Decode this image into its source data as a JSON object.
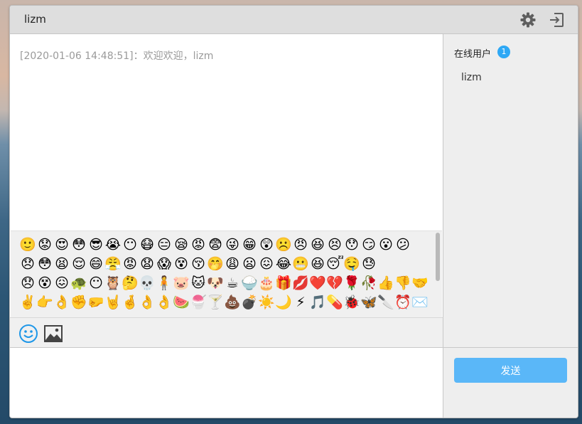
{
  "window": {
    "title": "lizm"
  },
  "header": {
    "settings_icon": "gear-icon",
    "logout_icon": "logout-icon"
  },
  "messages": [
    {
      "text": "[2020-01-06 14:48:51]：欢迎欢迎，lizm"
    }
  ],
  "emoji_rows": [
    [
      "🙂",
      "😟",
      "😍",
      "😳",
      "😎",
      "😭",
      "😶",
      "😷",
      "😑",
      "😪",
      "😡",
      "😨",
      "😜",
      "😁",
      "😲",
      "☹️",
      "😠",
      "😆",
      "😣",
      "😯",
      "😏",
      "😮",
      "😕"
    ],
    [
      "😞",
      "😳",
      "😫",
      "😌",
      "😄",
      "😤",
      "😡",
      "😧",
      "😱",
      "😵",
      "😚",
      "🤭",
      "😩",
      "😦",
      "😖",
      "😂",
      "😬",
      "😆",
      "😴",
      "🤤",
      "😓"
    ],
    [
      "😞",
      "😵",
      "😖",
      "🐢",
      "😶",
      "🦉",
      "🤔",
      "💀",
      "🧍",
      "🐷",
      "🐱",
      "🐶",
      "☕",
      "🍚",
      "🎂",
      "🎁",
      "💋",
      "❤️",
      "💔",
      "🌹",
      "🥀",
      "👍",
      "👎",
      "🤝"
    ],
    [
      "✌️",
      "👉",
      "👌",
      "✊",
      "🤛",
      "🤘",
      "🤞",
      "👌",
      "👌",
      "🍉",
      "🍧",
      "🍸",
      "💩",
      "💣",
      "☀️",
      "🌙",
      "⚡",
      "🎵",
      "💊",
      "🐞",
      "🦋",
      "🔪",
      "⏰",
      "✉️"
    ]
  ],
  "toolbar": {
    "emoji_icon": "emoji-icon",
    "image_icon": "image-icon"
  },
  "input": {
    "value": "",
    "placeholder": ""
  },
  "sidebar": {
    "online_label": "在线用户",
    "online_count": "1",
    "users": [
      "lizm"
    ]
  },
  "send": {
    "label": "发送"
  },
  "colors": {
    "accent": "#2ea8f5",
    "send_button": "#5ab7f8",
    "titlebar": "#dedede",
    "sidebar": "#eeeeee"
  }
}
